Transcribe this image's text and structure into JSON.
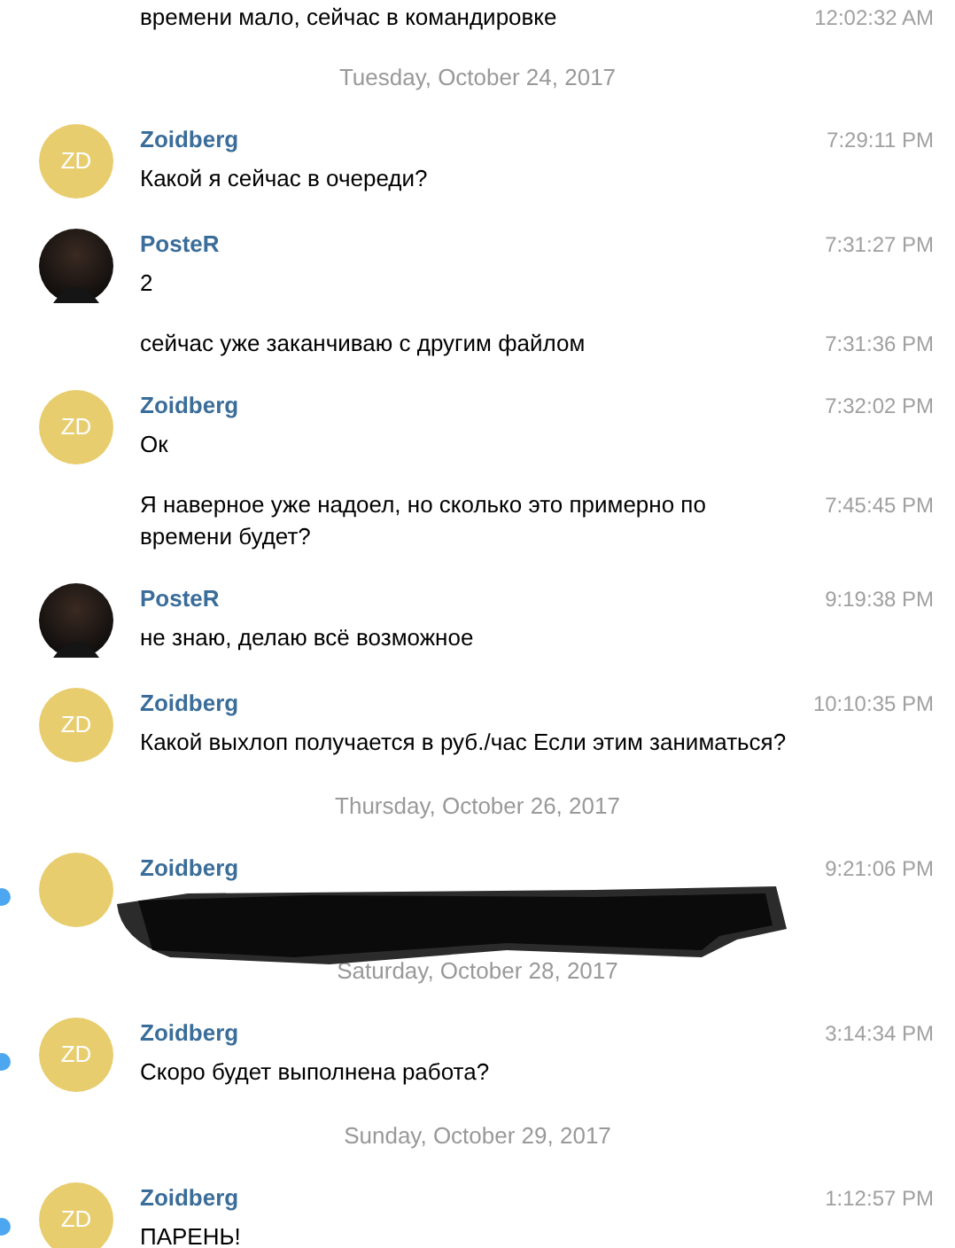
{
  "items": [
    {
      "kind": "continuation",
      "messages": [
        {
          "text": "времени мало, сейчас в командировке",
          "time": "12:02:32 AM"
        }
      ]
    },
    {
      "kind": "date",
      "label": "Tuesday, October 24, 2017"
    },
    {
      "kind": "group",
      "author": "Zoidberg",
      "avatar": {
        "kind": "initials",
        "initials": "ZD"
      },
      "unread": false,
      "redacted": false,
      "messages": [
        {
          "text": "Какой я сейчас в очереди?",
          "time": "7:29:11 PM"
        }
      ]
    },
    {
      "kind": "group",
      "author": "PosteR",
      "avatar": {
        "kind": "photo"
      },
      "unread": false,
      "redacted": false,
      "messages": [
        {
          "text": "2",
          "time": "7:31:27 PM"
        },
        {
          "text": "сейчас уже заканчиваю с другим файлом",
          "time": "7:31:36 PM"
        }
      ]
    },
    {
      "kind": "group",
      "author": "Zoidberg",
      "avatar": {
        "kind": "initials",
        "initials": "ZD"
      },
      "unread": false,
      "redacted": false,
      "messages": [
        {
          "text": "Ок",
          "time": "7:32:02 PM"
        },
        {
          "text": "Я наверное уже надоел, но сколько это примерно по времени будет?",
          "time": "7:45:45 PM"
        }
      ]
    },
    {
      "kind": "group",
      "author": "PosteR",
      "avatar": {
        "kind": "photo"
      },
      "unread": false,
      "redacted": false,
      "messages": [
        {
          "text": "не знаю, делаю всё возможное",
          "time": "9:19:38 PM"
        }
      ]
    },
    {
      "kind": "group",
      "author": "Zoidberg",
      "avatar": {
        "kind": "initials",
        "initials": "ZD"
      },
      "unread": false,
      "redacted": false,
      "messages": [
        {
          "text": "Какой выхлоп получается в руб./час Если этим заниматься?",
          "time": "10:10:35 PM"
        }
      ]
    },
    {
      "kind": "date",
      "label": "Thursday, October 26, 2017"
    },
    {
      "kind": "group",
      "author": "Zoidberg",
      "avatar": {
        "kind": "blank"
      },
      "unread": true,
      "redacted": true,
      "messages": [
        {
          "time": "9:21:06 PM"
        }
      ]
    },
    {
      "kind": "date",
      "label": "Saturday, October 28, 2017"
    },
    {
      "kind": "group",
      "author": "Zoidberg",
      "avatar": {
        "kind": "initials",
        "initials": "ZD"
      },
      "unread": true,
      "redacted": false,
      "messages": [
        {
          "text": "Скоро будет выполнена работа?",
          "time": "3:14:34 PM"
        }
      ]
    },
    {
      "kind": "date",
      "label": "Sunday, October 29, 2017"
    },
    {
      "kind": "group",
      "author": "Zoidberg",
      "avatar": {
        "kind": "initials",
        "initials": "ZD"
      },
      "unread": true,
      "redacted": false,
      "messages": [
        {
          "text": "ПАРЕНЬ!",
          "time": "1:12:57 PM"
        }
      ]
    }
  ]
}
